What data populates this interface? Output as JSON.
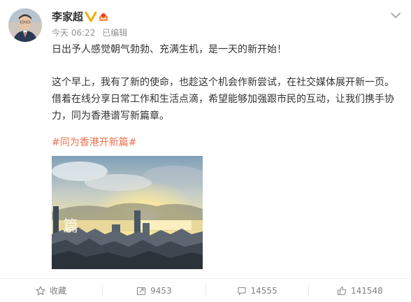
{
  "author": {
    "name": "李家超"
  },
  "meta": {
    "time": "今天 06:22",
    "edited": "已编辑"
  },
  "post": {
    "line1": "日出予人感觉朝气勃勃、充满生机，是一天的新开始！",
    "line2": "这个早上，我有了新的使命，也趁这个机会作新尝试，在社交媒体展开新一页。",
    "line3": "借着在线分享日常工作和生活点滴，希望能够加强跟市民的互动，让我们携手协",
    "line4": "力，同为香港谱写新篇章。",
    "hashtag": "#同为香港开新篇#",
    "image_caption": "篇"
  },
  "actions": {
    "favorite": {
      "label": "收藏",
      "icon": "star-icon"
    },
    "repost": {
      "count": "9453",
      "icon": "repost-icon"
    },
    "comment": {
      "count": "14555",
      "icon": "comment-icon"
    },
    "like": {
      "count": "141548",
      "icon": "thumbs-up-icon"
    }
  },
  "colors": {
    "accent": "#eb7350",
    "verified": "#f6ab00",
    "muted": "#939393",
    "text": "#333333"
  }
}
